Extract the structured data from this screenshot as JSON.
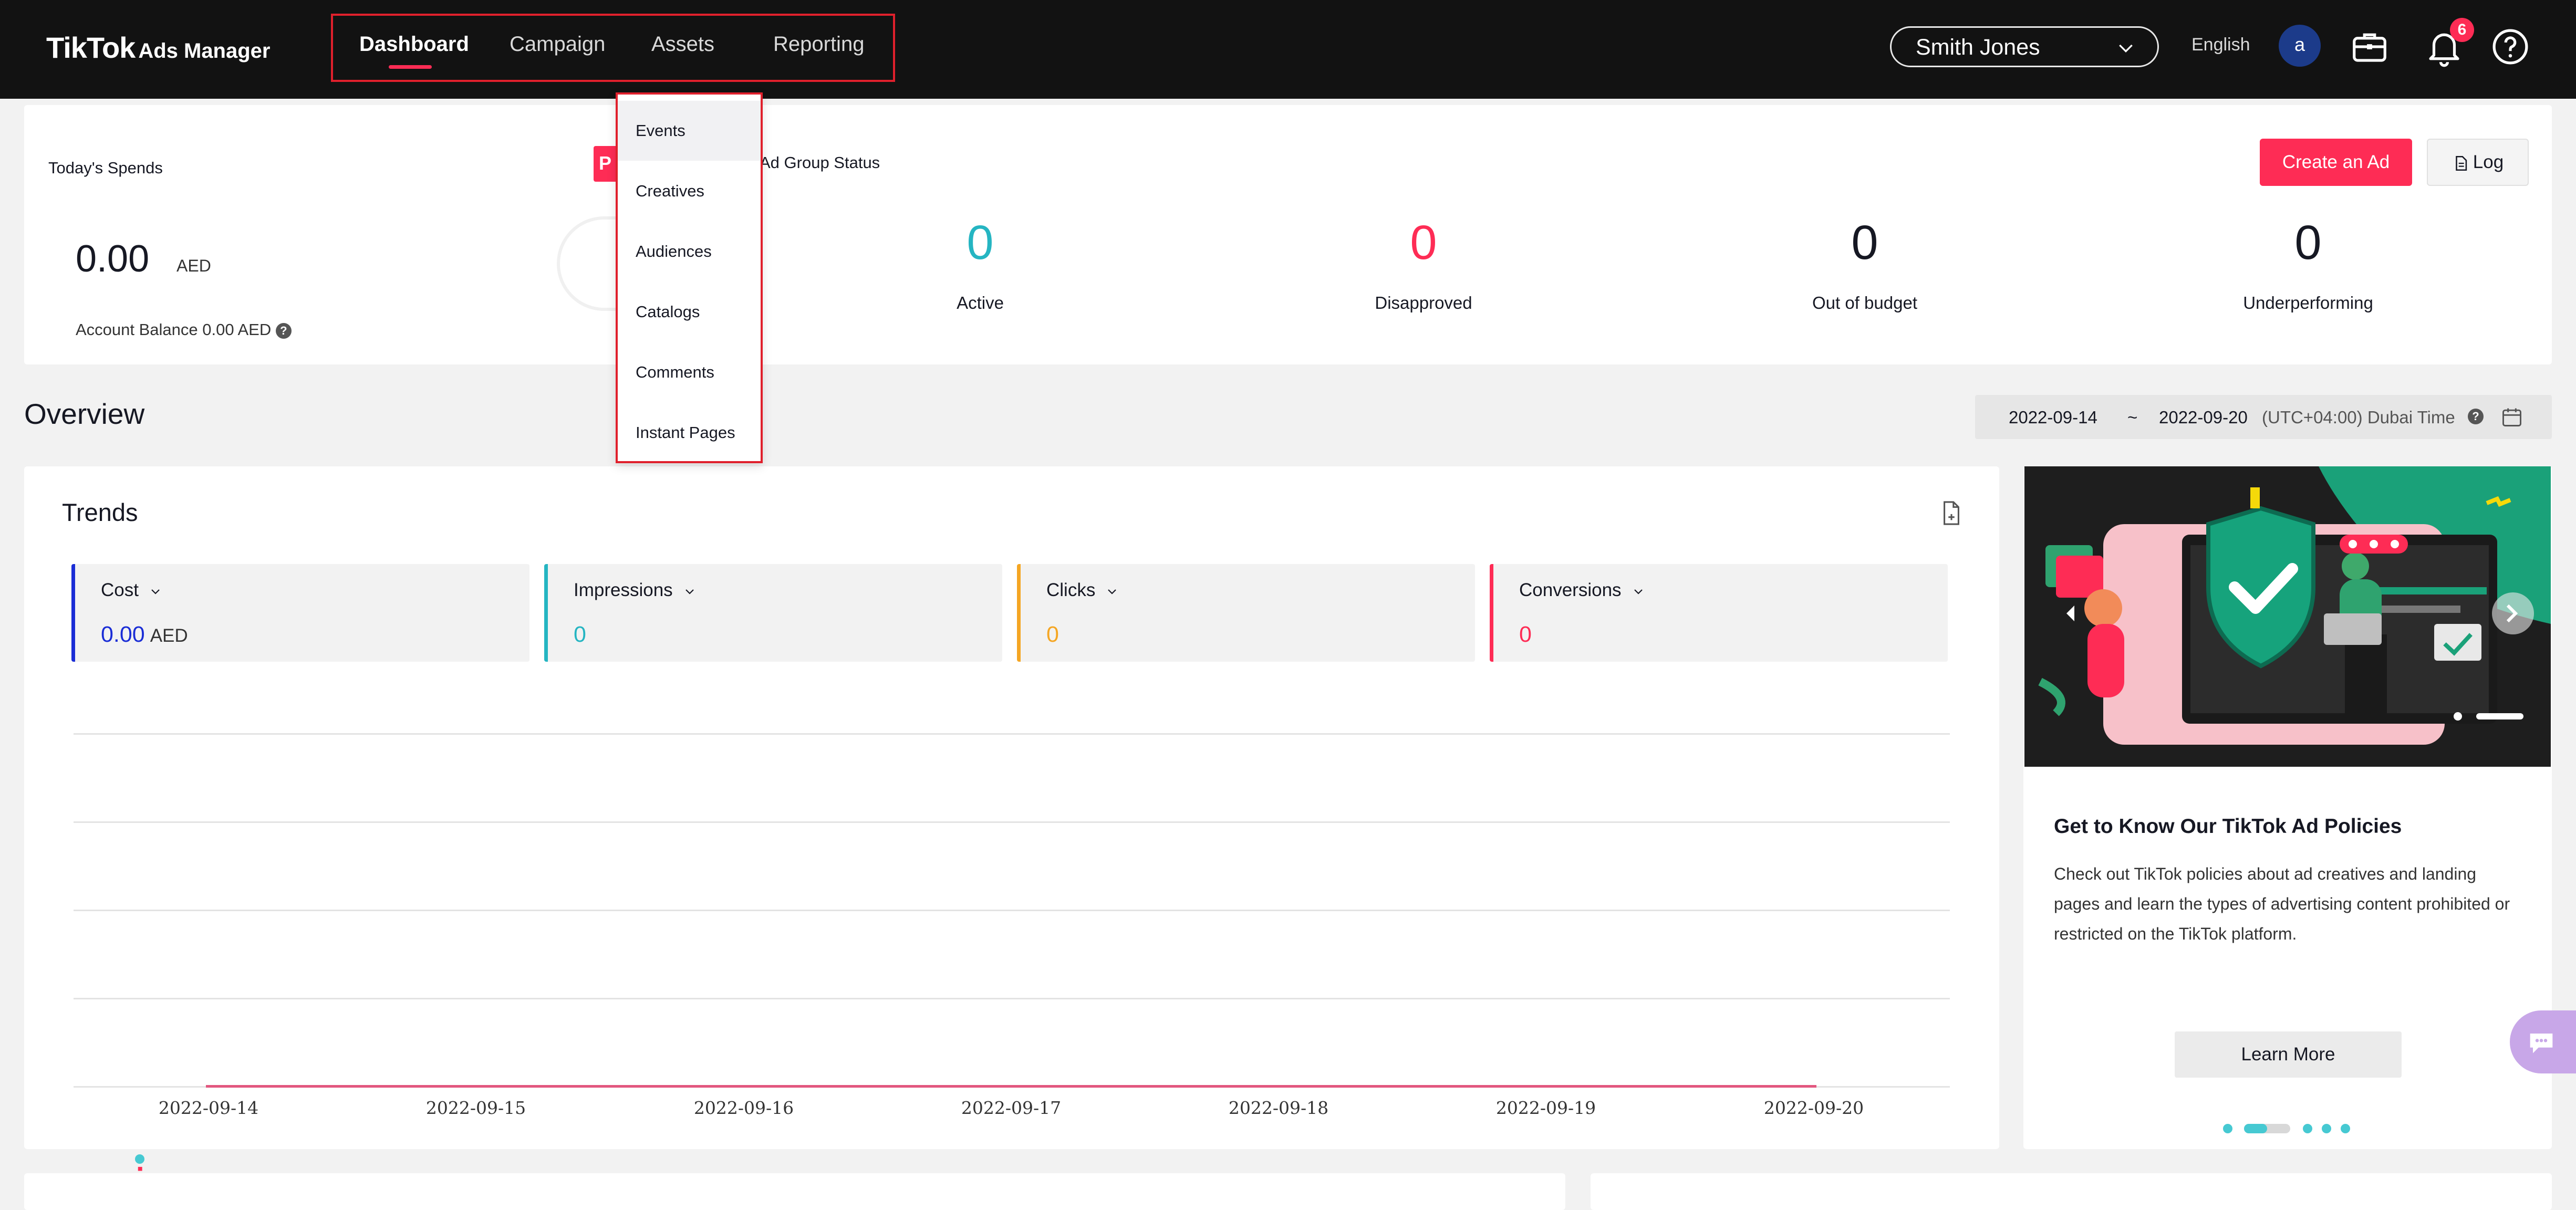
{
  "app": {
    "logo_main": "TikTok",
    "logo_sub": "Ads Manager"
  },
  "nav": {
    "items": [
      {
        "label": "Dashboard",
        "active": true
      },
      {
        "label": "Campaign"
      },
      {
        "label": "Assets"
      },
      {
        "label": "Reporting"
      }
    ]
  },
  "assets_menu": [
    "Events",
    "Creatives",
    "Audiences",
    "Catalogs",
    "Comments",
    "Instant Pages"
  ],
  "header": {
    "account": "Smith Jones",
    "language": "English",
    "avatar_initial": "a",
    "notifications_count": "6",
    "icons": [
      "briefcase-icon",
      "bell-icon",
      "help-icon"
    ]
  },
  "summary": {
    "spends_title": "Today's Spends",
    "spend_value": "0.00",
    "spend_currency": "AED",
    "account_balance": "Account Balance 0.00 AED",
    "ad_group_status_title": "Ad Group Status",
    "statuses": [
      {
        "label": "Active",
        "value": "0",
        "color": "#25b5c2"
      },
      {
        "label": "Disapproved",
        "value": "0",
        "color": "#fe2c55"
      },
      {
        "label": "Out of budget",
        "value": "0",
        "color": "#161823"
      },
      {
        "label": "Underperforming",
        "value": "0",
        "color": "#161823"
      }
    ],
    "create_button": "Create an Ad",
    "log_button": "Log"
  },
  "overview": {
    "title": "Overview",
    "date_start": "2022-09-14",
    "date_sep": "~",
    "date_end": "2022-09-20",
    "timezone": "(UTC+04:00) Dubai Time"
  },
  "trends": {
    "title": "Trends",
    "metrics": [
      {
        "name": "Cost",
        "value": "0.00",
        "unit": "AED",
        "color": "#1a2dd6"
      },
      {
        "name": "Impressions",
        "value": "0",
        "unit": "",
        "color": "#25b5c2"
      },
      {
        "name": "Clicks",
        "value": "0",
        "unit": "",
        "color": "#f5a623"
      },
      {
        "name": "Conversions",
        "value": "0",
        "unit": "",
        "color": "#fe2c55"
      }
    ],
    "x_labels": [
      "2022-09-14",
      "2022-09-15",
      "2022-09-16",
      "2022-09-17",
      "2022-09-18",
      "2022-09-19",
      "2022-09-20"
    ]
  },
  "promo": {
    "title": "Get to Know Our TikTok Ad Policies",
    "body": "Check out TikTok policies about ad creatives and landing pages and learn the types of advertising content prohibited or restricted on the TikTok platform.",
    "button": "Learn More",
    "carousel_count": 5,
    "carousel_active": 1
  }
}
